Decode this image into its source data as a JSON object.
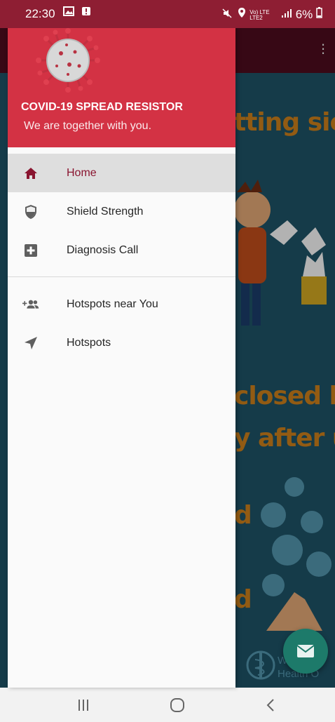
{
  "status_bar": {
    "time": "22:30",
    "network": "Vo) LTE LTE2",
    "battery": "6%",
    "bg_color": "#8e1e33"
  },
  "background_app": {
    "poster_lines": [
      "tting sick",
      "closed bin",
      "y after use",
      "d",
      "d"
    ],
    "organization_text": "World Health O",
    "fab_icon": "mail-icon"
  },
  "drawer": {
    "header": {
      "title": "COVID-19 SPREAD RESISTOR",
      "subtitle": "We are together with you.",
      "logo_icon": "coronavirus-icon",
      "bg_color": "#d33244"
    },
    "items": [
      {
        "label": "Home",
        "icon": "home-icon",
        "active": true
      },
      {
        "label": "Shield Strength",
        "icon": "shield-icon",
        "active": false
      },
      {
        "label": "Diagnosis Call",
        "icon": "medical-plus-icon",
        "active": false
      },
      {
        "label": "Hotspots near You",
        "icon": "add-group-icon",
        "active": false
      },
      {
        "label": "Hotspots",
        "icon": "navigation-arrow-icon",
        "active": false
      }
    ],
    "accent_color": "#8a1530"
  },
  "nav_bar": {
    "buttons": [
      "recents-icon",
      "home-circle-icon",
      "back-icon"
    ]
  }
}
